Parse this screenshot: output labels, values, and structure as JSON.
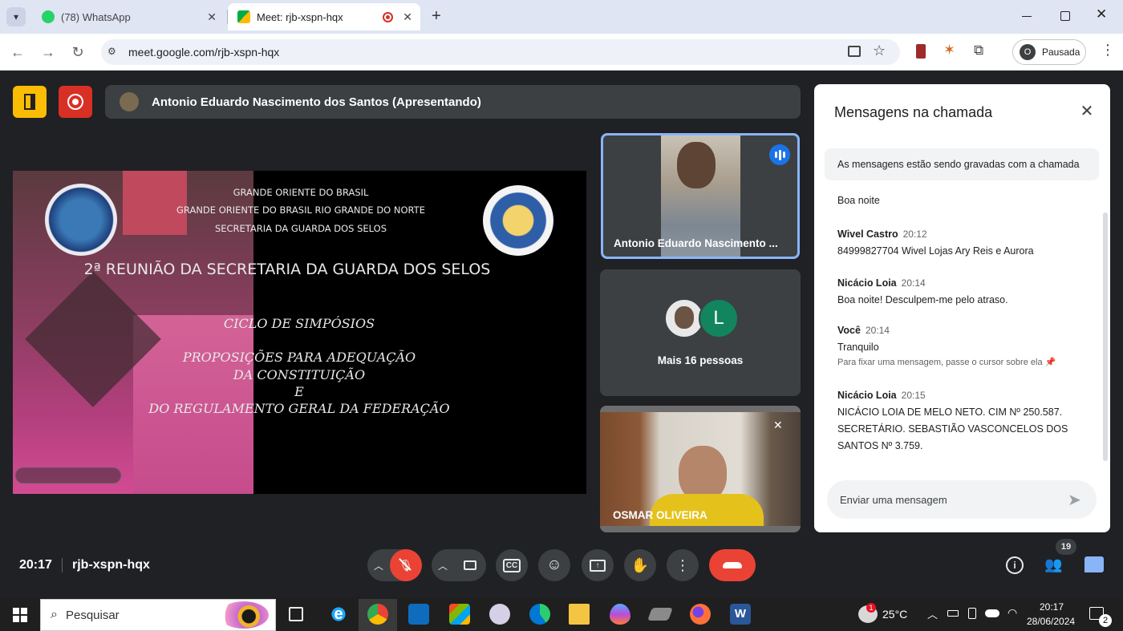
{
  "browser": {
    "tabs": [
      {
        "title": "(78) WhatsApp",
        "active": false
      },
      {
        "title": "Meet: rjb-xspn-hqx",
        "active": true
      }
    ],
    "url": "meet.google.com/rjb-xspn-hqx",
    "profile": {
      "initial": "O",
      "label": "Pausada"
    }
  },
  "meet": {
    "presenter_banner": "Antonio Eduardo Nascimento dos Santos (Apresentando)",
    "slide": {
      "line1": "GRANDE ORIENTE DO BRASIL",
      "line2": "GRANDE ORIENTE DO BRASIL RIO GRANDE DO NORTE",
      "line3": "SECRETARIA DA GUARDA DOS SELOS",
      "title": "2ª REUNIÃO  DA SECRETARIA DA GUARDA DOS SELOS",
      "sub1": "CICLO DE SIMPÓSIOS",
      "sub2": "PROPOSIÇÕES PARA ADEQUAÇÃO",
      "sub3": "DA CONSTITUIÇÃO",
      "sub4": "E",
      "sub5": "DO REGULAMENTO GERAL DA FEDERAÇÃO"
    },
    "tiles": {
      "speaker_name": "Antonio Eduardo Nascimento ...",
      "group_avatar_letter": "L",
      "group_label": "Mais 16 pessoas",
      "third_name": "OSMAR OLIVEIRA"
    },
    "footer": {
      "time": "20:17",
      "code": "rjb-xspn-hqx",
      "participants_badge": "19"
    }
  },
  "chat": {
    "title": "Mensagens na chamada",
    "notice": "As mensagens estão sendo gravadas com a chamada",
    "first_message": "Boa noite",
    "messages": [
      {
        "sender": "Wivel Castro",
        "time": "20:12",
        "text": "84999827704 Wivel Lojas Ary Reis e Aurora"
      },
      {
        "sender": "Nicácio Loia",
        "time": "20:14",
        "text": "Boa noite! Desculpem-me pelo atraso."
      },
      {
        "sender": "Você",
        "time": "20:14",
        "text": "Tranquilo",
        "hint": "Para fixar uma mensagem, passe o cursor sobre ela"
      },
      {
        "sender": "Nicácio Loia",
        "time": "20:15",
        "text_lines": [
          "NICÁCIO LOIA DE MELO NETO. CIM Nº 250.587.",
          "SECRETÁRIO. SEBASTIÃO VASCONCELOS DOS",
          "SANTOS Nº 3.759."
        ]
      }
    ],
    "input_placeholder": "Enviar uma mensagem"
  },
  "taskbar": {
    "search_placeholder": "Pesquisar",
    "weather": "25°C",
    "weather_badge": "1",
    "clock_time": "20:17",
    "clock_date": "28/06/2024",
    "notif_count": "2"
  },
  "colors": {
    "accent_blue": "#1a73e8",
    "end_call_red": "#ea4335",
    "mic_off_red": "#ea4335",
    "yellow_button": "#fbbc04"
  }
}
